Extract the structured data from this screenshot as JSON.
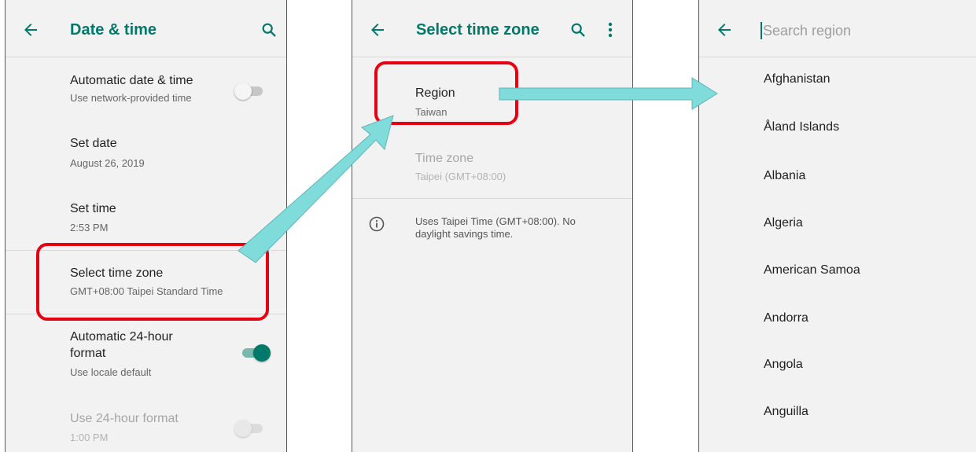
{
  "colors": {
    "accent": "#00796b",
    "highlight": "#e60012",
    "arrow": "#7fdcdb"
  },
  "screen1": {
    "title": "Date & time",
    "auto_date": {
      "title": "Automatic date & time",
      "subtitle": "Use network-provided time",
      "enabled": false
    },
    "set_date": {
      "title": "Set date",
      "subtitle": "August 26, 2019"
    },
    "set_time": {
      "title": "Set time",
      "subtitle": "2:53 PM"
    },
    "time_zone": {
      "title": "Select time zone",
      "subtitle": "GMT+08:00 Taipei Standard Time"
    },
    "auto_24h": {
      "title_line1": "Automatic 24-hour",
      "title_line2": "format",
      "subtitle": "Use locale default",
      "enabled": true
    },
    "use_24h": {
      "title": "Use 24-hour format",
      "subtitle": "1:00 PM",
      "enabled": false,
      "disabled": true
    }
  },
  "screen2": {
    "title": "Select time zone",
    "region": {
      "title": "Region",
      "subtitle": "Taiwan"
    },
    "time_zone": {
      "title": "Time zone",
      "subtitle": "Taipei (GMT+08:00)"
    },
    "info_line1": "Uses Taipei Time (GMT+08:00). No",
    "info_line2": "daylight savings time."
  },
  "screen3": {
    "search_placeholder": "Search region",
    "regions": [
      "Afghanistan",
      "Åland Islands",
      "Albania",
      "Algeria",
      "American Samoa",
      "Andorra",
      "Angola",
      "Anguilla"
    ]
  }
}
